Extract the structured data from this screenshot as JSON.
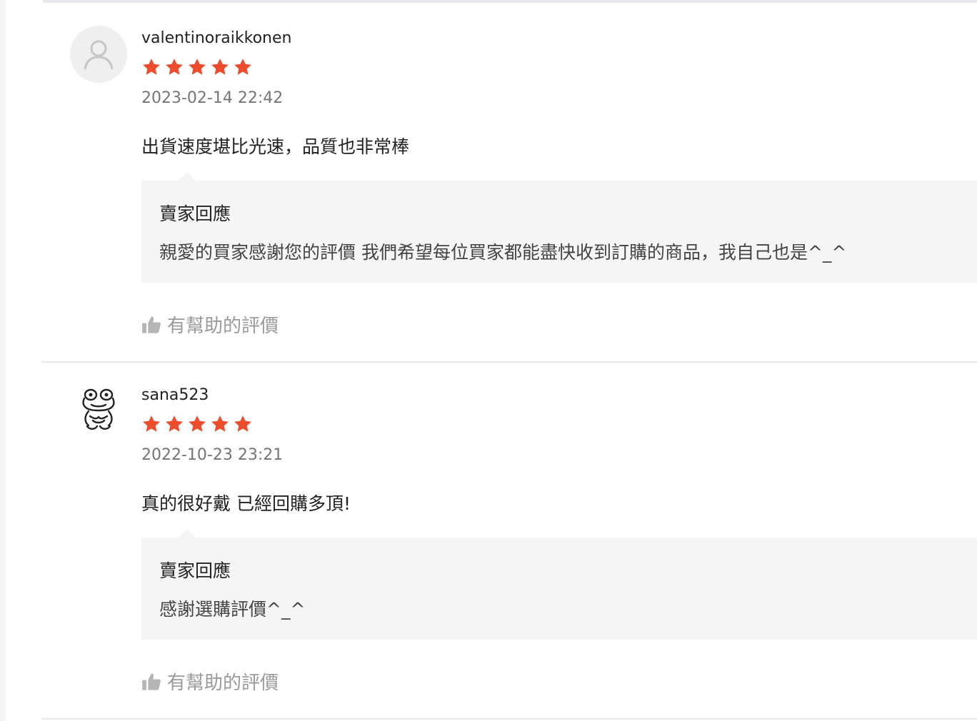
{
  "colors": {
    "star": "#ee4d2d",
    "text": "#222222",
    "muted": "#757575",
    "helpful": "#9a9a9a",
    "reply_bg": "#f5f5f5"
  },
  "reviews": [
    {
      "username": "valentinoraikkonen",
      "avatar_icon": "default-user-icon",
      "rating": 5,
      "timestamp": "2023-02-14 22:42",
      "comment": "出貨速度堪比光速，品質也非常棒",
      "reply": {
        "title": "賣家回應",
        "body": "親愛的買家感謝您的評價 我們希望每位買家都能盡快收到訂購的商品，我自己也是^_^"
      },
      "helpful_label": "有幫助的評價",
      "helpful_icon": "thumbs-up-icon"
    },
    {
      "username": "sana523",
      "avatar_icon": "frog-avatar-icon",
      "rating": 5,
      "timestamp": "2022-10-23 23:21",
      "comment": "真的很好戴 已經回購多頂!",
      "reply": {
        "title": "賣家回應",
        "body": "感謝選購評價^_^"
      },
      "helpful_label": "有幫助的評價",
      "helpful_icon": "thumbs-up-icon"
    }
  ]
}
